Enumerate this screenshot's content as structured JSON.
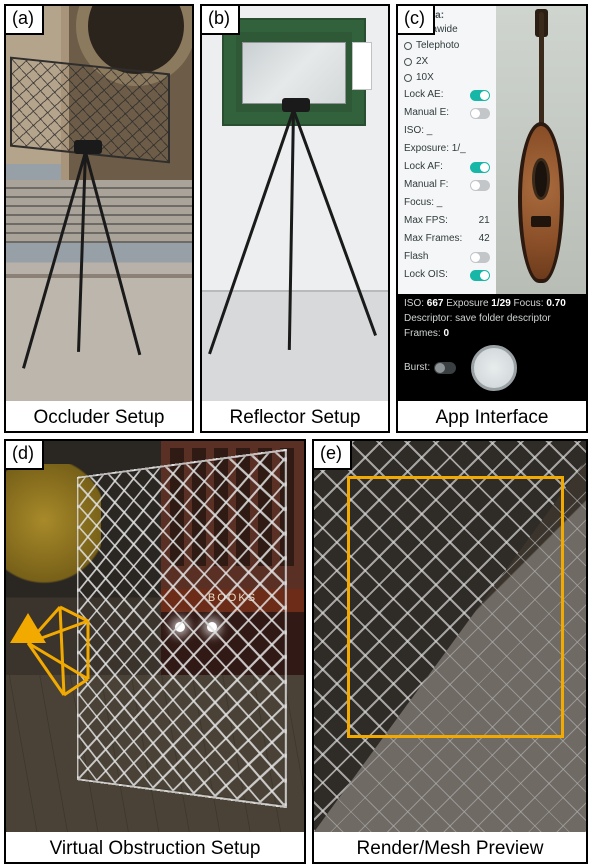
{
  "panels": {
    "a": {
      "tag": "(a)",
      "caption": "Occluder Setup"
    },
    "b": {
      "tag": "(b)",
      "caption": "Reflector Setup"
    },
    "c": {
      "tag": "(c)",
      "caption": "App Interface"
    },
    "d": {
      "tag": "(d)",
      "caption": "Virtual Obstruction Setup",
      "storefront_sign": "BOOKS"
    },
    "e": {
      "tag": "(e)",
      "caption": "Render/Mesh Preview"
    }
  },
  "app": {
    "camera_header": "Camera:",
    "options": [
      {
        "label": "Ultrawide"
      },
      {
        "label": "Telephoto"
      },
      {
        "label": "2X"
      },
      {
        "label": "10X"
      }
    ],
    "rows": [
      {
        "label": "Lock AE:",
        "on": true
      },
      {
        "label": "Manual E:",
        "on": false
      },
      {
        "label": "ISO: _"
      },
      {
        "label": "Exposure: 1/_"
      },
      {
        "label": "Lock AF:",
        "on": true
      },
      {
        "label": "Manual F:",
        "on": false
      },
      {
        "label": "Focus: _"
      },
      {
        "label": "Max FPS:",
        "value": "21"
      },
      {
        "label": "Max Frames:",
        "value": "42"
      },
      {
        "label": "Flash",
        "on": false
      },
      {
        "label": "Lock OIS:",
        "on": true
      }
    ],
    "status": {
      "iso_label": "ISO:",
      "iso": "667",
      "exposure_label": "Exposure",
      "exposure": "1/29",
      "focus_label": "Focus:",
      "focus": "0.70",
      "descriptor_label": "Descriptor:",
      "descriptor_value": "save folder descriptor",
      "frames_label": "Frames:",
      "frames": "0",
      "burst_label": "Burst:"
    }
  }
}
